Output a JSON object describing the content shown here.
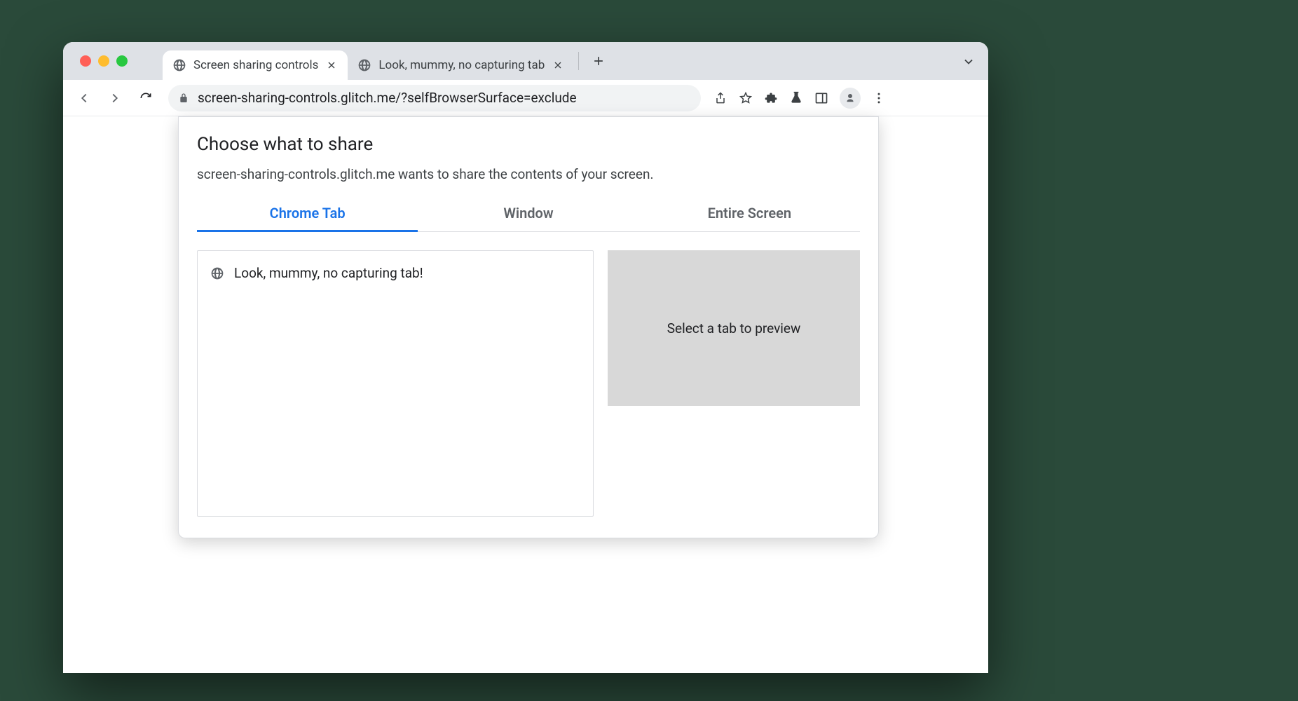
{
  "browser": {
    "tabs": [
      {
        "title": "Screen sharing controls",
        "active": true
      },
      {
        "title": "Look, mummy, no capturing tab",
        "active": false
      }
    ],
    "url": "screen-sharing-controls.glitch.me/?selfBrowserSurface=exclude"
  },
  "dialog": {
    "title": "Choose what to share",
    "subtitle": "screen-sharing-controls.glitch.me wants to share the contents of your screen.",
    "tabs": {
      "chrome_tab": "Chrome Tab",
      "window": "Window",
      "entire_screen": "Entire Screen"
    },
    "list_items": [
      {
        "label": "Look, mummy, no capturing tab!"
      }
    ],
    "preview_placeholder": "Select a tab to preview"
  }
}
